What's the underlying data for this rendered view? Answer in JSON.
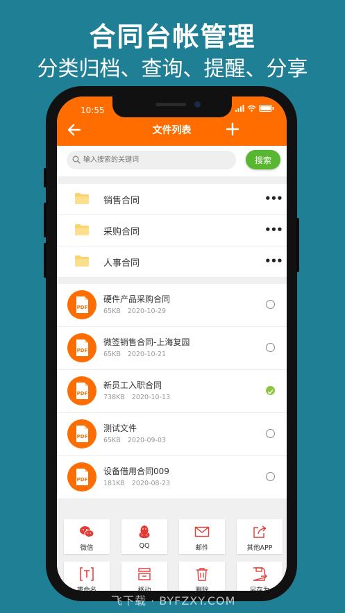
{
  "promo": {
    "title": "合同台帐管理",
    "subtitle": "分类归档、查询、提醒、分享"
  },
  "status_bar": {
    "time": "10:55"
  },
  "nav": {
    "title": "文件列表",
    "back_icon": "arrow-left-icon",
    "add_icon": "plus-icon"
  },
  "search": {
    "placeholder": "输入搜索的关键词",
    "button_label": "搜索"
  },
  "folders": [
    {
      "name": "销售合同"
    },
    {
      "name": "采购合同"
    },
    {
      "name": "人事合同"
    }
  ],
  "files": [
    {
      "name": "硬件产品采购合同",
      "size": "65KB",
      "date": "2020-10-29",
      "selected": false,
      "icon_label": "PDF"
    },
    {
      "name": "微签销售合同-上海复园",
      "size": "65KB",
      "date": "2020-10-21",
      "selected": false,
      "icon_label": "PDF"
    },
    {
      "name": "新员工入职合同",
      "size": "738KB",
      "date": "2020-10-13",
      "selected": true,
      "icon_label": "PDF"
    },
    {
      "name": "测试文件",
      "size": "65KB",
      "date": "2020-09-03",
      "selected": false,
      "icon_label": "PDF"
    },
    {
      "name": "设备借用合同009",
      "size": "181KB",
      "date": "2020-08-23",
      "selected": false,
      "icon_label": "PDF"
    }
  ],
  "actions": [
    {
      "label": "微信",
      "icon": "wechat-icon"
    },
    {
      "label": "QQ",
      "icon": "qq-icon"
    },
    {
      "label": "邮件",
      "icon": "mail-icon"
    },
    {
      "label": "其他APP",
      "icon": "share-icon"
    },
    {
      "label": "重命名",
      "icon": "rename-icon"
    },
    {
      "label": "移动",
      "icon": "move-icon"
    },
    {
      "label": "删除",
      "icon": "trash-icon"
    },
    {
      "label": "另存为",
      "icon": "save-as-icon"
    }
  ],
  "watermark": "飞下载 · BYFZXY.COM",
  "colors": {
    "accent": "#ff6d00",
    "search_button": "#59b630",
    "checked": "#8cc63f",
    "background": "#1f7f95"
  }
}
